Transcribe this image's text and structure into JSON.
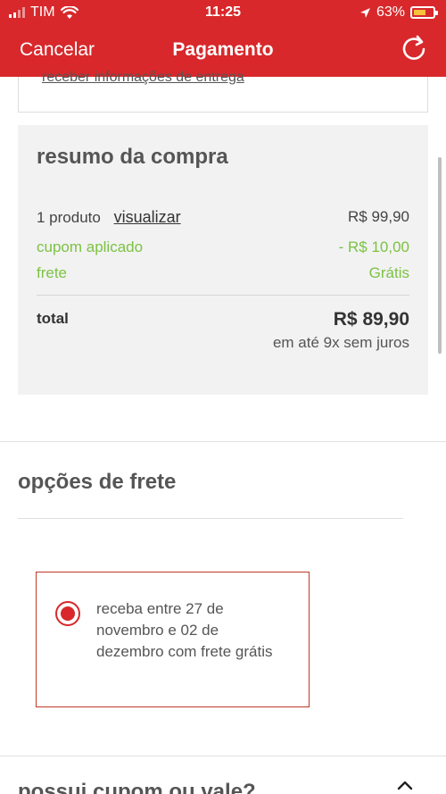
{
  "status_bar": {
    "carrier": "TIM",
    "time": "11:25",
    "battery": "63%",
    "battery_level": 0.63,
    "icons": [
      "signal-icon",
      "wifi-icon",
      "location-arrow-icon",
      "battery-icon"
    ]
  },
  "nav": {
    "cancel_label": "Cancelar",
    "title": "Pagamento",
    "refresh_icon": "refresh-icon"
  },
  "partial_card": {
    "text": "receber informações de entrega"
  },
  "summary": {
    "title": "resumo da compra",
    "product_label": "1 produto",
    "view_link": "visualizar",
    "product_value": "R$ 99,90",
    "coupon_label": "cupom aplicado",
    "coupon_value": "- R$ 10,00",
    "shipping_label": "frete",
    "shipping_value": "Grátis",
    "total_label": "total",
    "total_value": "R$ 89,90",
    "installments": "em até 9x sem juros"
  },
  "shipping": {
    "title": "opções de frete",
    "option_text": "receba entre 27 de novembro e 02 de dezembro com frete grátis",
    "option_selected": true
  },
  "coupon_section": {
    "title": "possui cupom ou vale?"
  },
  "colors": {
    "brand_red": "#d8282b",
    "green": "#7cc243",
    "panel_gray": "#f2f2f2"
  }
}
